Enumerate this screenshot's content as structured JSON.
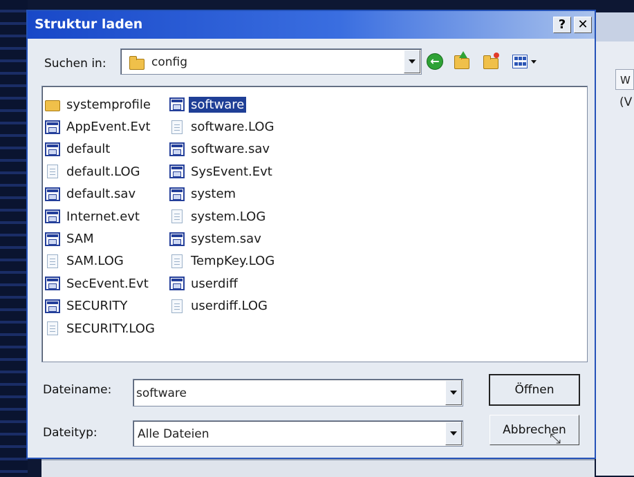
{
  "dialog": {
    "title": "Struktur laden",
    "help_label": "?",
    "close_label": "✕"
  },
  "lookin": {
    "label": "Suchen in:",
    "value": "config"
  },
  "toolbar": {
    "back_glyph": "←"
  },
  "files": {
    "column1": [
      {
        "name": "systemprofile",
        "icon": "folder-icon"
      },
      {
        "name": "AppEvent.Evt",
        "icon": "registry-file-icon"
      },
      {
        "name": "default",
        "icon": "registry-file-icon"
      },
      {
        "name": "default.LOG",
        "icon": "document-icon"
      },
      {
        "name": "default.sav",
        "icon": "registry-file-icon"
      },
      {
        "name": "Internet.evt",
        "icon": "registry-file-icon"
      },
      {
        "name": "SAM",
        "icon": "registry-file-icon"
      },
      {
        "name": "SAM.LOG",
        "icon": "document-icon"
      },
      {
        "name": "SecEvent.Evt",
        "icon": "registry-file-icon"
      },
      {
        "name": "SECURITY",
        "icon": "registry-file-icon"
      },
      {
        "name": "SECURITY.LOG",
        "icon": "document-icon"
      }
    ],
    "column2": [
      {
        "name": "software",
        "icon": "registry-file-icon",
        "selected": true
      },
      {
        "name": "software.LOG",
        "icon": "document-icon"
      },
      {
        "name": "software.sav",
        "icon": "registry-file-icon"
      },
      {
        "name": "SysEvent.Evt",
        "icon": "registry-file-icon"
      },
      {
        "name": "system",
        "icon": "registry-file-icon"
      },
      {
        "name": "system.LOG",
        "icon": "document-icon"
      },
      {
        "name": "system.sav",
        "icon": "registry-file-icon"
      },
      {
        "name": "TempKey.LOG",
        "icon": "document-icon"
      },
      {
        "name": "userdiff",
        "icon": "registry-file-icon"
      },
      {
        "name": "userdiff.LOG",
        "icon": "document-icon"
      }
    ]
  },
  "filename": {
    "label": "Dateiname:",
    "value": "software"
  },
  "filetype": {
    "label": "Dateityp:",
    "value": "Alle Dateien"
  },
  "buttons": {
    "open": "Öffnen",
    "cancel": "Abbrechen"
  },
  "background": {
    "header_text": "W",
    "row_text": "(V"
  },
  "colors": {
    "title_start": "#1848c8",
    "title_end": "#a9c2ec",
    "selection": "#1f3f96",
    "dialog_bg": "#e6ebf2"
  }
}
